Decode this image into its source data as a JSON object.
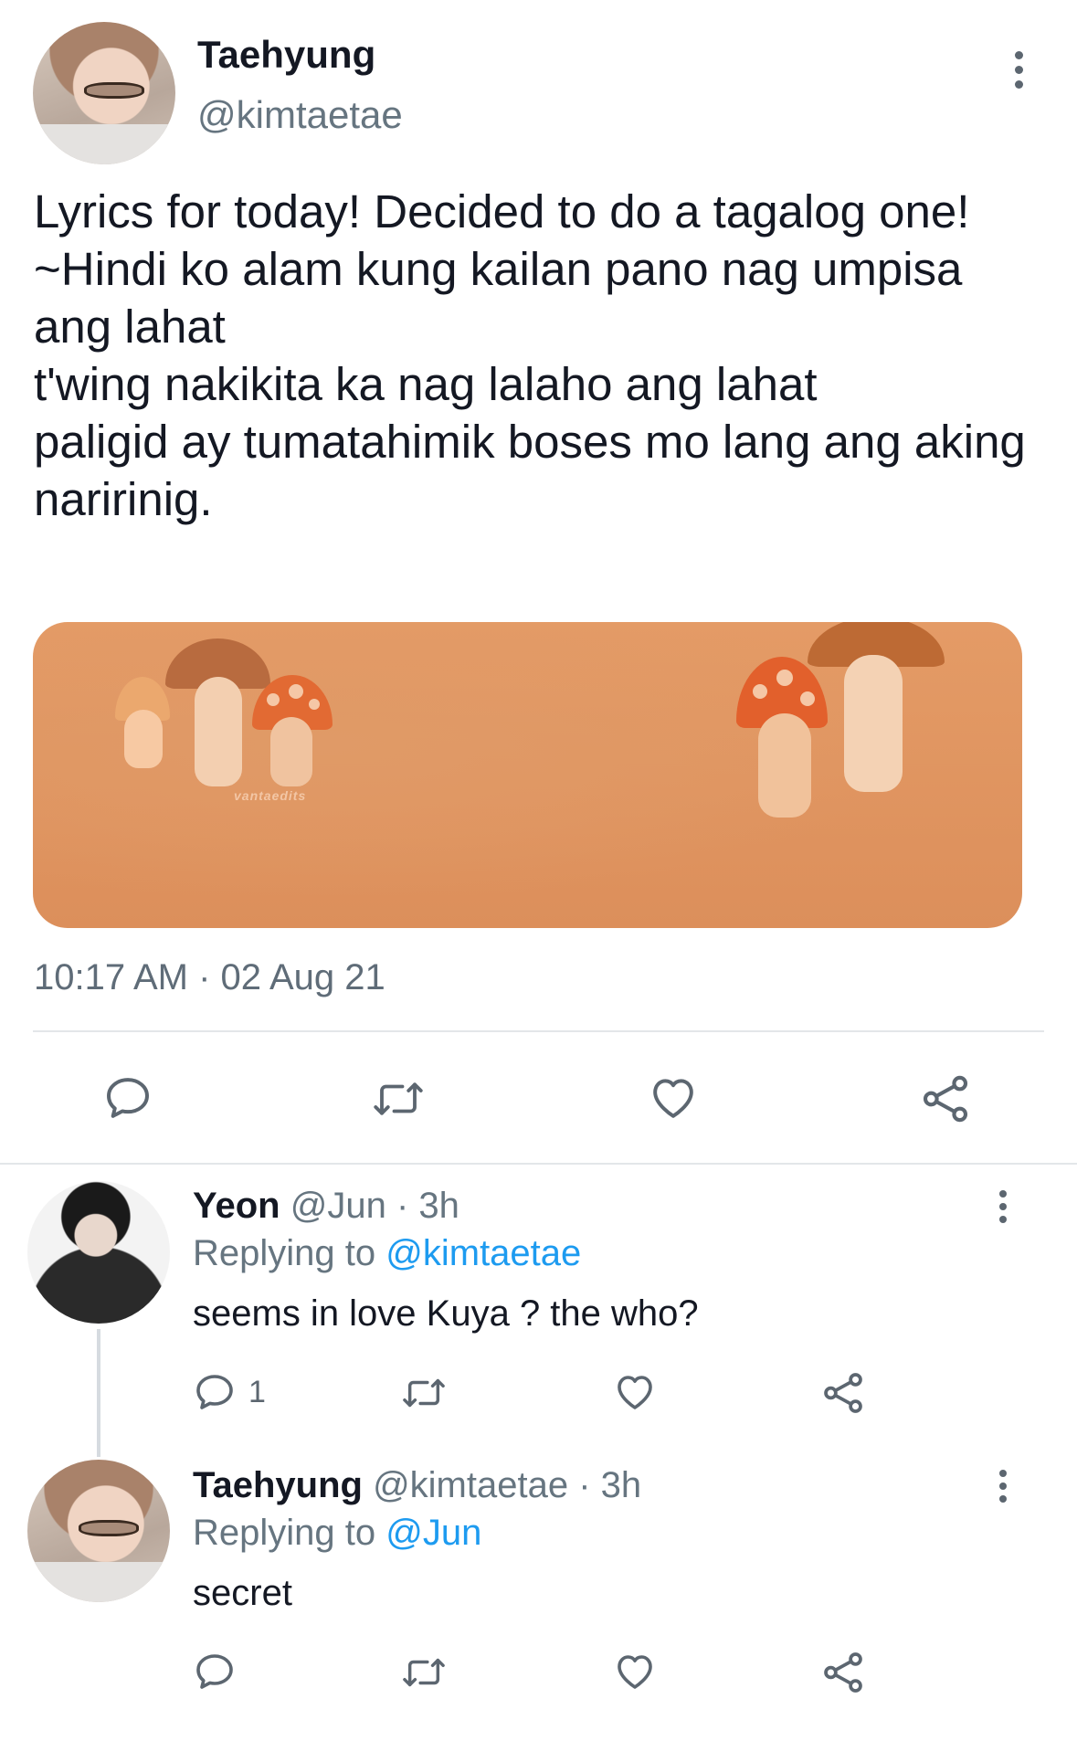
{
  "tweet": {
    "author_name": "Taehyung",
    "author_handle": "@kimtaetae",
    "text": "Lyrics for today! Decided to do a tagalog one!\n~Hindi ko alam kung kailan pano nag umpisa ang lahat\nt'wing nakikita ka nag lalaho ang lahat\npaligid ay tumatahimik boses mo lang ang aking naririnig.",
    "media_watermark": "vantaedits",
    "timestamp": "10:17 AM · 02 Aug 21",
    "actions": [
      "reply-icon",
      "retweet-icon",
      "like-icon",
      "share-icon"
    ]
  },
  "replies": [
    {
      "name": "Yeon",
      "handle": "@Jun",
      "age": "· 3h",
      "replying_label": "Replying to",
      "replying_to": "@kimtaetae",
      "text": "seems in love Kuya ? the who?",
      "reply_count": "1"
    },
    {
      "name": "Taehyung",
      "handle": "@kimtaetae",
      "age": "· 3h",
      "replying_label": "Replying to",
      "replying_to": "@Jun",
      "text": "secret",
      "reply_count": ""
    }
  ],
  "colors": {
    "link": "#1d9bf0",
    "muted": "#667580",
    "text": "#141823",
    "divider": "#e3e6e9",
    "media_bg": "#e09660"
  }
}
